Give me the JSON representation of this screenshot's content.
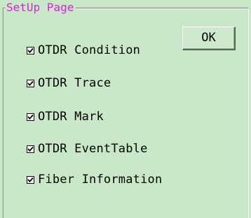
{
  "group": {
    "title": "SetUp Page"
  },
  "ok_button": {
    "label": "OK"
  },
  "options": [
    {
      "label": "OTDR Condition",
      "checked": true
    },
    {
      "label": "OTDR Trace",
      "checked": true
    },
    {
      "label": "OTDR Mark",
      "checked": true
    },
    {
      "label": "OTDR EventTable",
      "checked": true
    },
    {
      "label": "Fiber Information",
      "checked": true
    }
  ],
  "colors": {
    "background": "#c8e8c8",
    "group_title": "#e020e0"
  }
}
